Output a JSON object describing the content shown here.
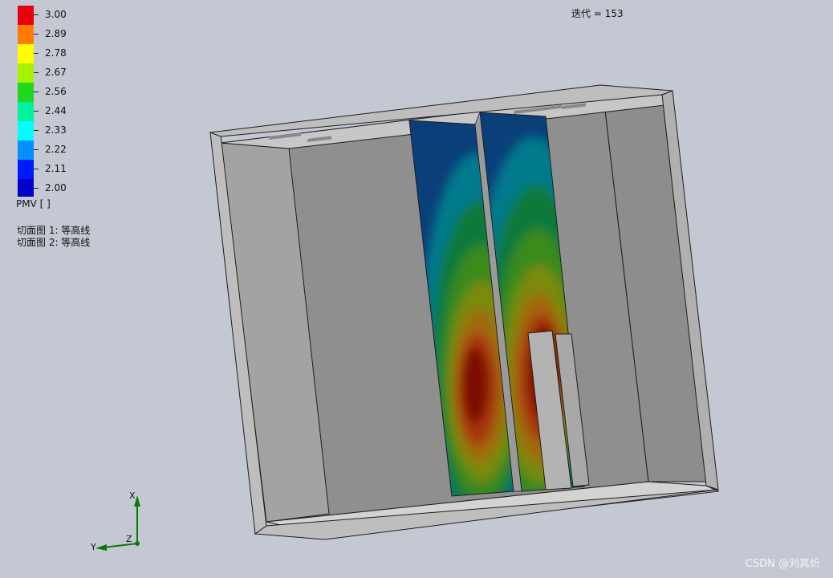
{
  "legend": {
    "colors": [
      "#e8000c",
      "#ff7c00",
      "#ffff00",
      "#a6f000",
      "#1ed81e",
      "#00f09c",
      "#00ffff",
      "#0090ff",
      "#0018ff",
      "#0000c8"
    ],
    "ticks": [
      "3.00",
      "2.89",
      "2.78",
      "2.67",
      "2.56",
      "2.44",
      "2.33",
      "2.22",
      "2.11",
      "2.00"
    ],
    "title": "PMV [ ]"
  },
  "plots": [
    "切面图 1: 等高线",
    "切面图 2: 等高线"
  ],
  "iteration_label": "迭代 = 153",
  "axes_triad": {
    "x": "X",
    "y": "Y",
    "z": "Z"
  },
  "watermark": "CSDN @刘其炘",
  "colors": {
    "background": "#c3c8d3",
    "wall": "#8e8e8e",
    "rim": "#bdbdbd"
  }
}
